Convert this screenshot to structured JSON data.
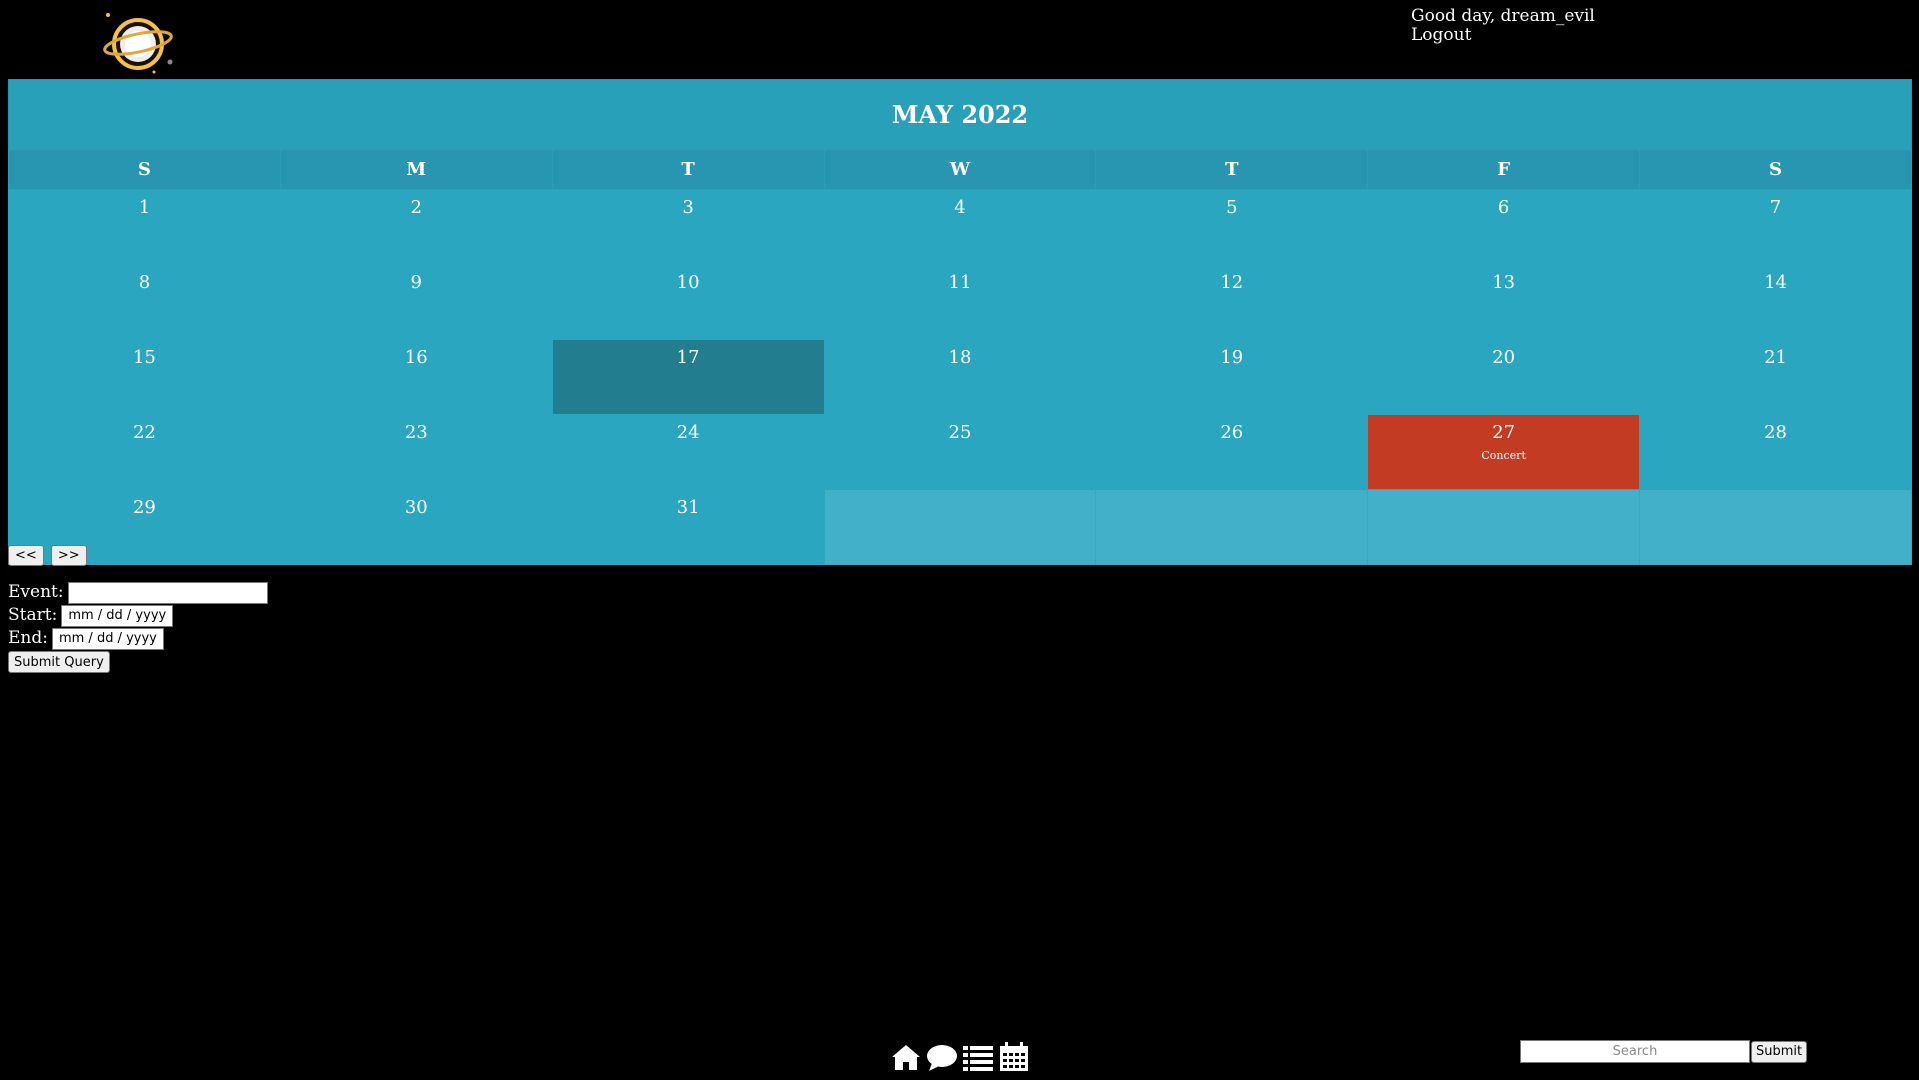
{
  "header": {
    "greeting": "Good day, dream_evil",
    "logout_label": "Logout"
  },
  "calendar": {
    "title": "MAY 2022",
    "weekdays": [
      "S",
      "M",
      "T",
      "W",
      "T",
      "F",
      "S"
    ],
    "weeks": [
      [
        "1",
        "2",
        "3",
        "4",
        "5",
        "6",
        "7"
      ],
      [
        "8",
        "9",
        "10",
        "11",
        "12",
        "13",
        "14"
      ],
      [
        "15",
        "16",
        "17",
        "18",
        "19",
        "20",
        "21"
      ],
      [
        "22",
        "23",
        "24",
        "25",
        "26",
        "27",
        "28"
      ],
      [
        "29",
        "30",
        "31",
        "",
        "",
        "",
        ""
      ]
    ],
    "highlighted_day": "17",
    "events": [
      {
        "day": "27",
        "label": "Concert"
      }
    ],
    "prev_label": "<<",
    "next_label": ">>"
  },
  "event_form": {
    "event_label": "Event:",
    "event_value": "",
    "start_label": "Start:",
    "start_placeholder": "mm / dd / yyyy",
    "end_label": "End:",
    "end_placeholder": "mm / dd / yyyy",
    "submit_label": "Submit Query"
  },
  "footer": {
    "icons": [
      "home-icon",
      "chat-icon",
      "list-icon",
      "calendar-icon"
    ],
    "search_placeholder": "Search",
    "search_submit_label": "Submit"
  },
  "colors": {
    "calendar_bg": "#2ba6c1",
    "today_bg": "#227e8f",
    "event_bg": "#c23b22",
    "page_bg": "#000000"
  }
}
